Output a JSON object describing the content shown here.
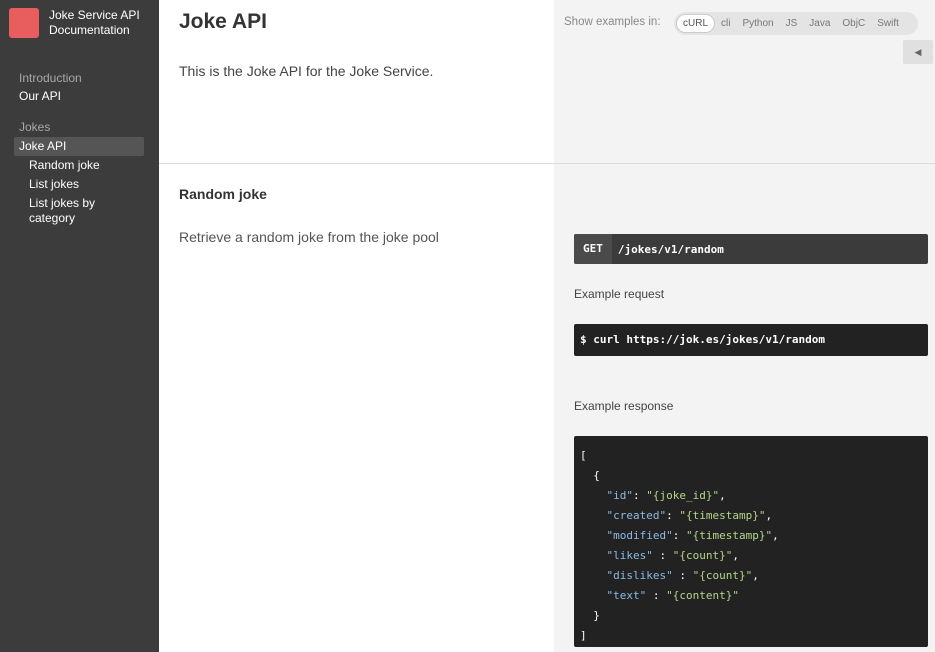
{
  "sidebar": {
    "brand": "Joke Service API Documentation",
    "sections": [
      {
        "label": "Introduction",
        "items": [
          {
            "label": "Our API"
          }
        ]
      },
      {
        "label": "Jokes",
        "items": [
          {
            "label": "Joke API",
            "active": true
          },
          {
            "label": "Random joke"
          },
          {
            "label": "List jokes"
          },
          {
            "label": "List jokes by category"
          }
        ]
      }
    ],
    "logo_color": "#e85d5d"
  },
  "main": {
    "title": "Joke API",
    "intro": "This is the Joke API for the Joke Service.",
    "section_title": "Random joke",
    "section_desc": "Retrieve a random joke from the joke pool"
  },
  "examples": {
    "label": "Show examples in:",
    "languages": [
      "cURL",
      "cli",
      "Python",
      "JS",
      "Java",
      "ObjC",
      "Swift"
    ],
    "active": "cURL",
    "endpoint_method": "GET",
    "endpoint_path": "/jokes/v1/random",
    "request_label": "Example request",
    "request_code": "$ curl https://jok.es/jokes/v1/random",
    "response_label": "Example response",
    "response_lines": [
      {
        "indent": "",
        "text": "["
      },
      {
        "indent": "  ",
        "text": "{"
      },
      {
        "indent": "    ",
        "key": "\"id\"",
        "sep": ": ",
        "val": "\"{joke_id}\"",
        "end": ","
      },
      {
        "indent": "    ",
        "key": "\"created\"",
        "sep": ": ",
        "val": "\"{timestamp}\"",
        "end": ","
      },
      {
        "indent": "    ",
        "key": "\"modified\"",
        "sep": ": ",
        "val": "\"{timestamp}\"",
        "end": ","
      },
      {
        "indent": "    ",
        "key": "\"likes\"",
        "sep": " : ",
        "val": "\"{count}\"",
        "end": ","
      },
      {
        "indent": "    ",
        "key": "\"dislikes\"",
        "sep": " : ",
        "val": "\"{count}\"",
        "end": ","
      },
      {
        "indent": "    ",
        "key": "\"text\"",
        "sep": " : ",
        "val": "\"{content}\"",
        "end": ""
      },
      {
        "indent": "  ",
        "text": "}"
      },
      {
        "indent": "",
        "text": "]"
      }
    ]
  }
}
